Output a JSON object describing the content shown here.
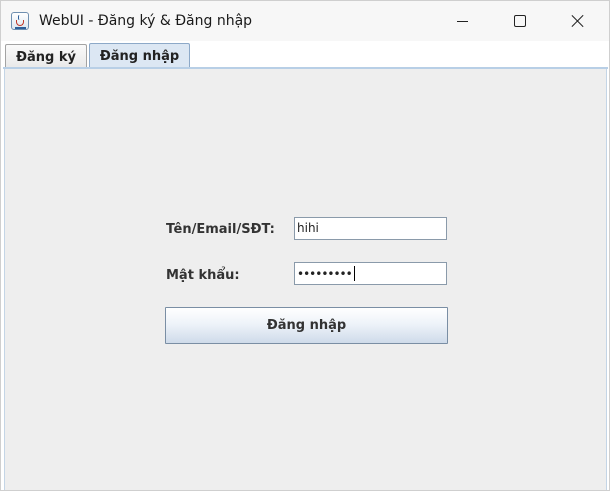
{
  "window": {
    "title": "WebUI - Đăng ký & Đăng nhập",
    "icon": "java-cup-icon"
  },
  "tabs": [
    {
      "label": "Đăng ký",
      "selected": false
    },
    {
      "label": "Đăng nhập",
      "selected": true
    }
  ],
  "login_form": {
    "username_label": "Tên/Email/SĐT:",
    "username_value": "hihi",
    "password_label": "Mật khẩu:",
    "password_masked": "•••••••••",
    "submit_label": "Đăng nhập"
  },
  "colors": {
    "panel_bg": "#eeeeee",
    "selected_tab_bg": "#dce7f3",
    "tab_accent": "#b8cfe6"
  }
}
